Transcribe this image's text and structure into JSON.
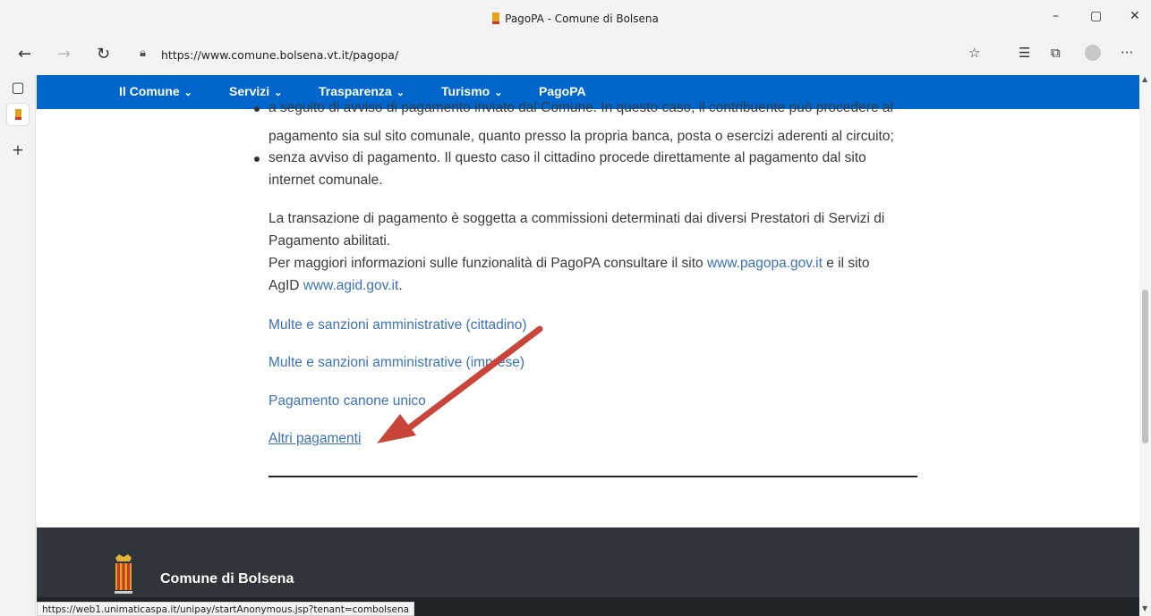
{
  "browser": {
    "window_title": "PagoPA - Comune di Bolsena",
    "url": "https://www.comune.bolsena.vt.it/pagopa/",
    "buttons": {
      "minimize": "–",
      "restore": "▢",
      "close": "✕",
      "back": "←",
      "forward": "→",
      "refresh": "↻",
      "more": "···"
    },
    "icons": [
      "favorites-add-icon",
      "favorites-icon",
      "collections-icon",
      "profile-icon"
    ]
  },
  "sidebar": {
    "add": "+"
  },
  "site_nav": {
    "items": [
      {
        "label": "Il Comune",
        "dropdown": true
      },
      {
        "label": "Servizi",
        "dropdown": true
      },
      {
        "label": "Trasparenza",
        "dropdown": true
      },
      {
        "label": "Turismo",
        "dropdown": true
      },
      {
        "label": "PagoPA",
        "dropdown": false
      }
    ],
    "chevron": "❯",
    "color": "#0066cc"
  },
  "content": {
    "bullet1_line1": "a seguito di avviso di pagamento inviato dal Comune. In questo caso, il contribuente può procedere al",
    "bullet1_line2": "pagamento sia sul sito comunale, quanto presso la propria banca, posta o esercizi aderenti al circuito;",
    "bullet2_line1": "senza avviso di pagamento. Il questo caso il cittadino procede direttamente al pagamento dal sito",
    "bullet2_line2": "internet comunale.",
    "para1_line1": "La transazione di pagamento è soggetta a commissioni determinati dai diversi Prestatori di Servizi di",
    "para1_line2": "Pagamento abilitati.",
    "para2_prefix": "Per maggiori informazioni sulle funzionalità di PagoPA consultare il sito ",
    "para2_link1": "www.pagopa.gov.it",
    "para2_mid": " e il sito",
    "para2_line2_prefix": "AgID ",
    "para2_link2": "www.agid.gov.it",
    "para2_line2_suffix": ".",
    "links": [
      "Multe e sanzioni amministrative (cittadino)",
      "Multe e sanzioni amministrative (imprese)",
      "Pagamento canone unico",
      "Altri pagamenti"
    ]
  },
  "footer": {
    "name": "Comune di Bolsena",
    "color": "#2f353b"
  },
  "status_bar": "https://web1.unimaticaspa.it/unipay/startAnonymous.jsp?tenant=combolsena",
  "annotation": {
    "arrow_color": "#c9453a"
  }
}
